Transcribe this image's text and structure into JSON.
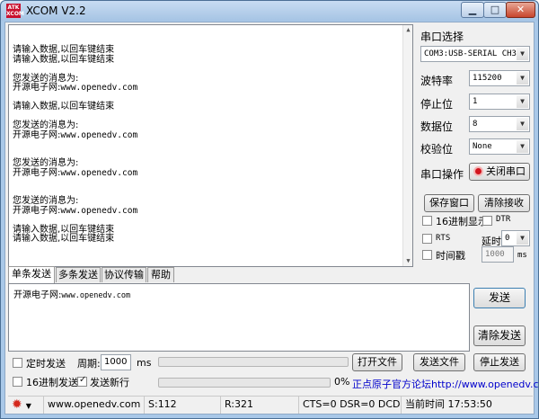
{
  "window": {
    "title": "XCOM V2.2",
    "app_icon_text": "ATK\nXCOM",
    "minimize": "▁",
    "maximize": "□",
    "close": "✕"
  },
  "receive": {
    "lines": [
      {
        "zh": "请输入数据,以回车键结束",
        "mono": ""
      },
      {
        "zh": "请输入数据,以回车键结束",
        "mono": ""
      },
      {
        "zh": "",
        "mono": ""
      },
      {
        "zh": "您发送的消息为:",
        "mono": ""
      },
      {
        "zh": "开源电子网:",
        "mono": "www.openedv.com"
      },
      {
        "zh": "",
        "mono": ""
      },
      {
        "zh": "请输入数据,以回车键结束",
        "mono": ""
      },
      {
        "zh": "",
        "mono": ""
      },
      {
        "zh": "您发送的消息为:",
        "mono": ""
      },
      {
        "zh": "开源电子网:",
        "mono": "www.openedv.com"
      },
      {
        "zh": "",
        "mono": ""
      },
      {
        "zh": "",
        "mono": ""
      },
      {
        "zh": "您发送的消息为:",
        "mono": ""
      },
      {
        "zh": "开源电子网:",
        "mono": "www.openedv.com"
      },
      {
        "zh": "",
        "mono": ""
      },
      {
        "zh": "",
        "mono": ""
      },
      {
        "zh": "您发送的消息为:",
        "mono": ""
      },
      {
        "zh": "开源电子网:",
        "mono": "www.openedv.com"
      },
      {
        "zh": "",
        "mono": ""
      },
      {
        "zh": "请输入数据,以回车键结束",
        "mono": ""
      },
      {
        "zh": "请输入数据,以回车键结束",
        "mono": ""
      }
    ]
  },
  "settings": {
    "port_label": "串口选择",
    "port_value": "COM3:USB-SERIAL CH340",
    "baud_label": "波特率",
    "baud_value": "115200",
    "stop_label": "停止位",
    "stop_value": "1",
    "data_label": "数据位",
    "data_value": "8",
    "parity_label": "校验位",
    "parity_value": "None",
    "operate_label": "串口操作",
    "close_port_button": "关闭串口",
    "save_window_button": "保存窗口",
    "clear_receive_button": "清除接收",
    "hex_display_label": "16进制显示",
    "dtr_label": "DTR",
    "rts_label": "RTS",
    "delay_label": "延时",
    "delay_value": "0",
    "timestamp_label": "时间戳",
    "timestamp_value": "1000",
    "timestamp_unit": "ms"
  },
  "tabs": [
    "单条发送",
    "多条发送",
    "协议传输",
    "帮助"
  ],
  "send": {
    "text_zh": "开源电子网:",
    "text_mono": "www.openedv.com",
    "send_button": "发送",
    "clear_send_button": "清除发送",
    "timed_send_label": "定时发送",
    "period_label": "周期:",
    "period_value": "1000",
    "period_unit": "ms",
    "hex_send_label": "16进制发送",
    "newline_label": "发送新行",
    "open_file_button": "打开文件",
    "send_file_button": "发送文件",
    "stop_send_button": "停止发送",
    "progress_text": "0%",
    "progress": 0,
    "forum_link": "正点原子官方论坛http://www.openedv.com/"
  },
  "status": {
    "website": "www.openedv.com",
    "sent": "S:112",
    "received": "R:321",
    "lines": "CTS=0 DSR=0 DCD=0",
    "time": "当前时间 17:53:50"
  },
  "colors": {
    "accent_red": "#c8102e",
    "link": "#0000cc"
  }
}
